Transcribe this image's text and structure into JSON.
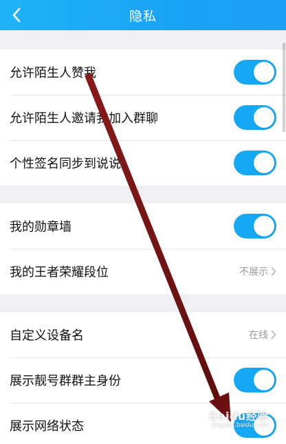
{
  "header": {
    "title": "隐私",
    "back_icon": "chevron-left-icon"
  },
  "groups": [
    {
      "items": [
        {
          "label": "允许陌生人赞我",
          "control": "toggle",
          "on": true
        },
        {
          "label": "允许陌生人邀请我加入群聊",
          "control": "toggle",
          "on": true
        },
        {
          "label": "个性签名同步到说说",
          "control": "toggle",
          "on": true
        }
      ]
    },
    {
      "items": [
        {
          "label": "我的勋章墙",
          "control": "toggle",
          "on": true
        },
        {
          "label": "我的王者荣耀段位",
          "control": "value",
          "value": "不展示"
        }
      ]
    },
    {
      "items": [
        {
          "label": "自定义设备名",
          "control": "value",
          "value": "在线"
        },
        {
          "label": "展示靓号群群主身份",
          "control": "toggle",
          "on": true
        },
        {
          "label": "展示网络状态",
          "control": "toggle",
          "on": true
        }
      ]
    }
  ],
  "watermark": {
    "brand": "Baidu经验",
    "sub": "jingyan.baidu.com"
  },
  "colors": {
    "accent": "#15a8f5",
    "header": "#1aa8f5",
    "annotation_arrow": "#7a1414",
    "background": "#f0f0f4"
  }
}
